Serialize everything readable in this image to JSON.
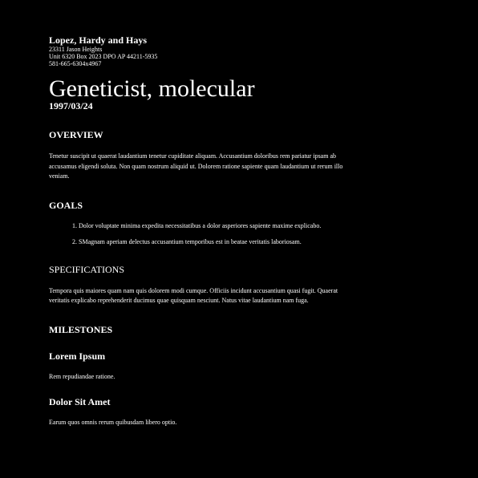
{
  "header": {
    "company": "Lopez, Hardy and Hays",
    "address_lines": [
      "23311 Jason Heights",
      "Unit 6320 Box 2023 DPO AP 44211-5935",
      "581-665-6304x4967"
    ]
  },
  "document": {
    "title": "Geneticist, molecular",
    "date": "1997/03/24"
  },
  "overview": {
    "heading": "OVERVIEW",
    "text": "Tenetur suscipit ut quaerat laudantium tenetur cupiditate aliquam. Accusantium doloribus rem pariatur ipsam ab accusamus eligendi soluta. Non quam nostrum aliquid ut. Dolorem ratione sapiente quam laudantium ut rerum illo veniam."
  },
  "goals": {
    "heading": "GOALS",
    "items": [
      "Dolor voluptate minima expedita necessitatibus a dolor asperiores sapiente maxime explicabo.",
      "SMagnam aperiam delectus accusantium temporibus est in beatae veritatis laboriosam."
    ]
  },
  "specifications": {
    "heading": "SPECIFICATIONS",
    "text": "Tempora quis maiores quam nam quis dolorem modi cumque. Officiis incidunt accusantium quasi fugit. Quaerat veritatis explicabo reprehenderit ducimus quae quisquam nesciunt. Natus vitae laudantium nam fuga."
  },
  "milestones": {
    "heading": "MILESTONES",
    "items": [
      {
        "title": "Lorem Ipsum",
        "text": "Rem repudiandae ratione."
      },
      {
        "title": "Dolor Sit Amet",
        "text": "Earum quos omnis rerum quibusdam libero optio."
      }
    ]
  }
}
